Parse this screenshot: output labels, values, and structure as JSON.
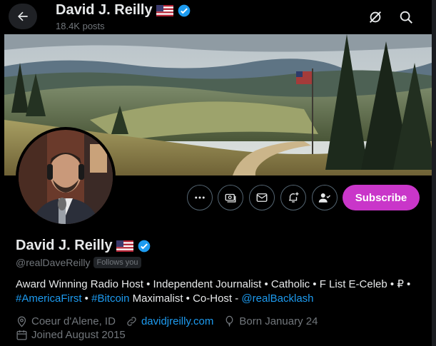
{
  "header": {
    "title": "David J. Reilly",
    "posts_count": "18.4K posts"
  },
  "profile": {
    "name": "David J. Reilly",
    "handle": "@realDaveReilly",
    "follows_you": "Follows you",
    "bio": {
      "line1": "Award Winning Radio Host • Independent Journalist • Catholic • F List E-Celeb • ₽ •",
      "tag1": "#AmericaFirst",
      "sep1": " • ",
      "tag2": "#Bitcoin",
      "mid": " Maximalist • Co-Host - ",
      "mention": "@realBacklash"
    },
    "location": "Coeur d'Alene, ID",
    "website": "davidjreilly.com",
    "birthday": "Born January 24",
    "joined": "Joined August 2015"
  },
  "actions": {
    "subscribe_label": "Subscribe"
  },
  "colors": {
    "accent": "#1d9bf0",
    "subscribe": "#c936c9",
    "muted": "#71767b"
  }
}
